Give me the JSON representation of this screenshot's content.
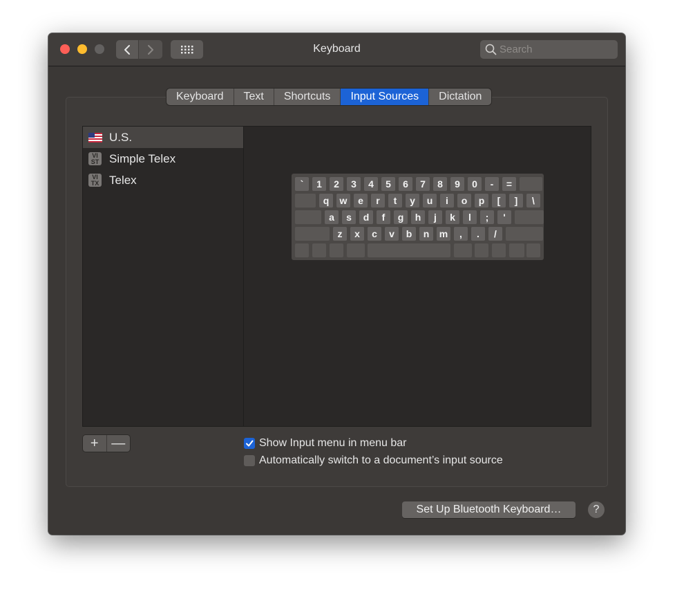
{
  "window": {
    "title": "Keyboard"
  },
  "search": {
    "placeholder": "Search"
  },
  "tabs": [
    {
      "label": "Keyboard",
      "selected": false
    },
    {
      "label": "Text",
      "selected": false
    },
    {
      "label": "Shortcuts",
      "selected": false
    },
    {
      "label": "Input Sources",
      "selected": true
    },
    {
      "label": "Dictation",
      "selected": false
    }
  ],
  "input_sources": [
    {
      "label": "U.S.",
      "icon": "us-flag-icon",
      "selected": true
    },
    {
      "label": "Simple Telex",
      "icon": "vi-st-icon",
      "badge": [
        "VI",
        "ST"
      ],
      "selected": false
    },
    {
      "label": "Telex",
      "icon": "vi-tx-icon",
      "badge": [
        "VI",
        "TX"
      ],
      "selected": false
    }
  ],
  "keyboard_rows": [
    [
      "`",
      "1",
      "2",
      "3",
      "4",
      "5",
      "6",
      "7",
      "8",
      "9",
      "0",
      "-",
      "="
    ],
    [
      "q",
      "w",
      "e",
      "r",
      "t",
      "y",
      "u",
      "i",
      "o",
      "p",
      "[",
      "]",
      "\\"
    ],
    [
      "a",
      "s",
      "d",
      "f",
      "g",
      "h",
      "j",
      "k",
      "l",
      ";",
      "'"
    ],
    [
      "z",
      "x",
      "c",
      "v",
      "b",
      "n",
      "m",
      ",",
      ".",
      "/"
    ]
  ],
  "list_controls": {
    "add_label": "+",
    "remove_label": "—"
  },
  "options": {
    "show_input_menu": {
      "label": "Show Input menu in menu bar",
      "checked": true
    },
    "auto_switch": {
      "label": "Automatically switch to a document’s input source",
      "checked": false
    }
  },
  "bluetooth_button": {
    "label": "Set Up Bluetooth Keyboard…"
  },
  "help_button": {
    "label": "?"
  },
  "colors": {
    "accent": "#1c63d6",
    "window_bg": "#3b3836",
    "panel_bg": "#2a2827"
  }
}
